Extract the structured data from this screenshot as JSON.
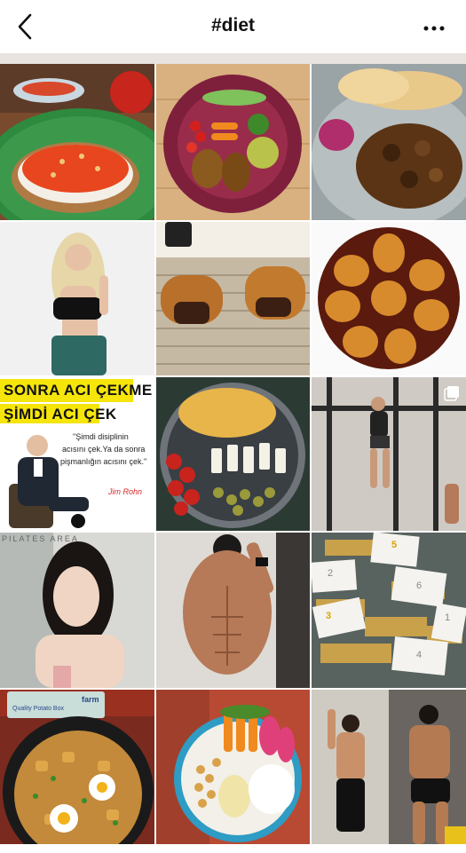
{
  "header": {
    "title": "#diet",
    "back_icon": "chevron-left-icon",
    "more_icon": "more-horizontal-icon"
  },
  "quote_post": {
    "headline_1": "SONRA ACI ÇEKME",
    "headline_2": "ŞİMDİ ACI ÇEK",
    "quote_1": "\"Şimdi disiplinin",
    "quote_2": "acısını çek.Ya da sonra",
    "quote_3": "pişmanlığın acısını çek.\"",
    "author": "Jim Rohn",
    "accent_color": "#f5e50a",
    "author_color": "#d62525"
  },
  "studio_sign": "PILATES AREA",
  "product_box": {
    "brand": "farm",
    "label": "Quality Potato Box"
  },
  "note_numbers": [
    "5",
    "2",
    "6",
    "3",
    "1",
    "4"
  ],
  "multi_image_icon": "multiple-images-icon"
}
